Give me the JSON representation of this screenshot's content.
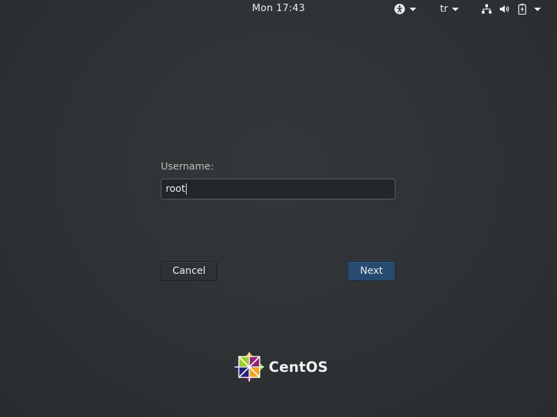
{
  "topbar": {
    "clock": "Mon 17:43",
    "language": "tr",
    "icons": [
      "accessibility-icon",
      "network-icon",
      "volume-icon",
      "battery-icon"
    ]
  },
  "login": {
    "username_label": "Username:",
    "username_value": "root",
    "cancel_label": "Cancel",
    "next_label": "Next"
  },
  "branding": {
    "logo_text": "CentOS"
  },
  "colors": {
    "background": "#2f3335",
    "next_button": "#274a70",
    "text": "#eeeeec"
  }
}
